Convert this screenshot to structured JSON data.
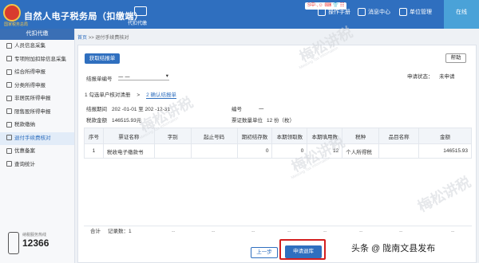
{
  "app": {
    "title": "自然人电子税务局（扣缴端）",
    "logo_text": "国家税务总局"
  },
  "top_center_label": "代扣代缴",
  "sogou": "S中·,☺ ⌨ 👕 ☷",
  "top_tools": [
    "操作手册",
    "消息中心",
    "单位管理",
    "在线"
  ],
  "sidebar": {
    "header": "代扣代缴",
    "items": [
      "人员信息采集",
      "专项附加扣除信息采集",
      "综合所得申报",
      "分类所得申报",
      "非居民所得申报",
      "限售股所得申报",
      "税款缴纳",
      "退付手续费核对",
      "优惠备案",
      "查询统计"
    ],
    "active_index": 7,
    "hotline_label": "纳税服务热线",
    "hotline": "12366"
  },
  "breadcrumb": {
    "home": "首页",
    "sep": ">>",
    "current": "退付手续费核对"
  },
  "buttons": {
    "get_result": "获取结报单",
    "help": "帮助",
    "prev": "上一步",
    "apply": "申请退库"
  },
  "status": {
    "label": "申请状态：",
    "value": "未申请"
  },
  "report_field": {
    "label": "结报单编号",
    "value": "一 一"
  },
  "steps": [
    {
      "label": "1 勾选单户核对清册"
    },
    {
      "label": ">"
    },
    {
      "label": "2 确认结报单"
    }
  ],
  "summary": {
    "period_label": "结报期间",
    "period_value": "202 -01-01  至  202 -12-31",
    "tax_label": "税款金额",
    "tax_value": "146515.93元",
    "no_label": "编号",
    "no_value": "一",
    "unit_label": "票证数量单位",
    "unit_value": "12 份（枚）"
  },
  "table": {
    "headers": [
      "序号",
      "票证名称",
      "字别",
      "起止号码",
      "期初结存数",
      "本期领取数",
      "本期填用数",
      "税种",
      "品目名称",
      "金额"
    ],
    "rows": [
      [
        "1",
        "税收电子缴款书",
        "",
        "",
        "0",
        "0",
        "12",
        "个人所得税",
        "",
        "146515.93"
      ]
    ]
  },
  "footer": {
    "total_label": "合计",
    "count_label": "记录数：1",
    "placeholders": [
      "--",
      "--",
      "--",
      "--",
      "--",
      "--",
      "--",
      "--"
    ]
  },
  "watermark": {
    "main": "梅松讲税",
    "sub": "Meisong Tax Information"
  },
  "credit": "头条 @ 陇南文县发布",
  "colors": {
    "primary": "#2f6fbf",
    "highlight": "#d41f1f"
  }
}
